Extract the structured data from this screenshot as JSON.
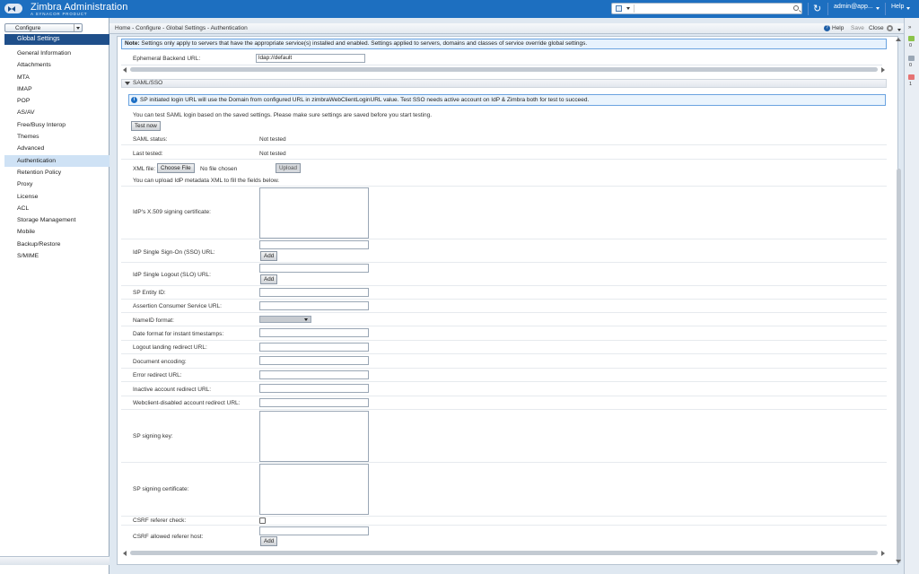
{
  "app": {
    "title": "Zimbra Administration",
    "subtitle": "A SYNACOR PRODUCT",
    "search_placeholder": "",
    "user": "admin@app...",
    "help": "Help"
  },
  "sidebar": {
    "dropdown": "Configure",
    "header": "Global Settings",
    "items": [
      {
        "label": "General Information"
      },
      {
        "label": "Attachments"
      },
      {
        "label": "MTA"
      },
      {
        "label": "IMAP"
      },
      {
        "label": "POP"
      },
      {
        "label": "AS/AV"
      },
      {
        "label": "Free/Busy Interop"
      },
      {
        "label": "Themes"
      },
      {
        "label": "Advanced"
      },
      {
        "label": "Authentication"
      },
      {
        "label": "Retention Policy"
      },
      {
        "label": "Proxy"
      },
      {
        "label": "License"
      },
      {
        "label": "ACL"
      },
      {
        "label": "Storage Management"
      },
      {
        "label": "Mobile"
      },
      {
        "label": "Backup/Restore"
      },
      {
        "label": "S/MIME"
      }
    ],
    "selected": "Authentication"
  },
  "toolbar": {
    "breadcrumb": "Home - Configure - Global Settings - Authentication",
    "help": "Help",
    "save": "Save",
    "close": "Close"
  },
  "note": {
    "prefix": "Note:",
    "text": " Settings only apply to servers that have the appropriate service(s) installed and enabled. Settings applied to servers, domains and classes of service override global settings."
  },
  "ephemeral": {
    "label": "Ephemeral Backend URL:",
    "value": "ldap://default"
  },
  "saml": {
    "section_title": "SAML/SSO",
    "info": "SP initiated login URL will use the Domain from configured URL in zimbraWebClientLoginURL value. Test SSO needs active account on IdP & Zimbra both for test to succeed.",
    "test_hint": "You can test SAML login based on the saved settings. Please make sure settings are saved before you start testing.",
    "test_button": "Test now",
    "status_label": "SAML status:",
    "status_value": "Not tested",
    "last_tested_label": "Last tested:",
    "last_tested_value": "Not tested",
    "xml_label": "XML file:",
    "choose_file": "Choose File",
    "no_file": "No file chosen",
    "upload": "Upload",
    "upload_hint": "You can upload IdP metadata XML to fill the fields below.",
    "idp_cert_label": "IdP's X.509 signing certificate:",
    "sso_url_label": "IdP Single Sign-On (SSO) URL:",
    "slo_url_label": "IdP Single Logout (SLO) URL:",
    "add": "Add",
    "entity_id_label": "SP Entity ID:",
    "acs_url_label": "Assertion Consumer Service URL:",
    "nameid_label": "NameID format:",
    "date_format_label": "Date format for instant timestamps:",
    "logout_redirect_label": "Logout landing redirect URL:",
    "doc_encoding_label": "Document encoding:",
    "error_redirect_label": "Error redirect URL:",
    "inactive_redirect_label": "Inactive account redirect URL:",
    "webclient_disabled_label": "Webclient-disabled account redirect URL:",
    "sp_key_label": "SP signing key:",
    "sp_cert_label": "SP signing certificate:",
    "csrf_check_label": "CSRF referer check:",
    "csrf_host_label": "CSRF allowed referer host:"
  },
  "right_strip": {
    "counts": [
      "0",
      "0",
      "1"
    ]
  },
  "colors": {
    "topbar": "#1d6fc0",
    "sidebar_header": "#1f4f8a",
    "selected_row": "#cfe2f5",
    "info_border": "#6aa3e0"
  }
}
